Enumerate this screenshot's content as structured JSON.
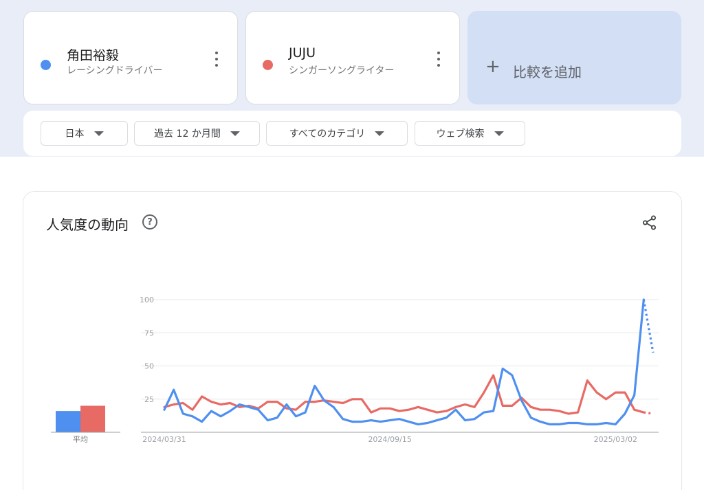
{
  "terms": [
    {
      "name": "角田裕毅",
      "type": "レーシングドライバー",
      "color": "#4e8ff0"
    },
    {
      "name": "JUJU",
      "type": "シンガーソングライター",
      "color": "#e86a64"
    }
  ],
  "add_compare": {
    "icon": "plus-icon",
    "label": "比較を追加"
  },
  "filters": {
    "region": "日本",
    "period": "過去 12 か月間",
    "category": "すべてのカテゴリ",
    "search_type": "ウェブ検索"
  },
  "panel": {
    "title": "人気度の動向",
    "help_icon": "help-circle-icon",
    "share_icon": "share-icon"
  },
  "chart_data": {
    "type": "line",
    "ylim": [
      0,
      100
    ],
    "y_ticks": [
      "100",
      "75",
      "50",
      "25"
    ],
    "x_ticks": [
      "2024/03/31",
      "2024/09/15",
      "2025/03/02"
    ],
    "x_tick_index": [
      0,
      24,
      48
    ],
    "grid": true,
    "partial_last_point": true,
    "average": {
      "label": "平均",
      "values": [
        16,
        20
      ]
    },
    "series": [
      {
        "name": "角田裕毅",
        "color": "#4e8ff0",
        "values": [
          17,
          32,
          14,
          12,
          8,
          16,
          12,
          16,
          21,
          19,
          17,
          9,
          11,
          21,
          12,
          15,
          35,
          24,
          19,
          10,
          8,
          8,
          9,
          8,
          9,
          10,
          8,
          6,
          7,
          9,
          11,
          17,
          9,
          10,
          15,
          16,
          48,
          43,
          24,
          11,
          8,
          6,
          6,
          7,
          7,
          6,
          6,
          7,
          6,
          14,
          28,
          100,
          60
        ]
      },
      {
        "name": "JUJU",
        "color": "#e86a64",
        "values": [
          19,
          21,
          22,
          17,
          27,
          23,
          21,
          22,
          19,
          20,
          18,
          23,
          23,
          18,
          17,
          23,
          23,
          24,
          23,
          22,
          25,
          25,
          15,
          18,
          18,
          16,
          17,
          19,
          17,
          15,
          16,
          19,
          21,
          19,
          30,
          43,
          20,
          20,
          26,
          19,
          17,
          17,
          16,
          14,
          15,
          39,
          30,
          25,
          30,
          30,
          17,
          15,
          14
        ]
      }
    ]
  }
}
